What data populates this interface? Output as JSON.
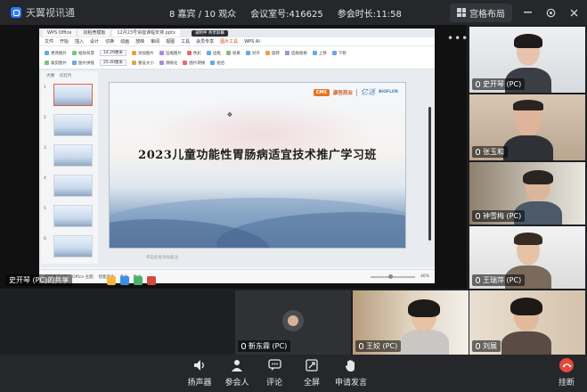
{
  "app": {
    "name": "天翼视讯通"
  },
  "topbar": {
    "attendance": "8 嘉宾 / 10 观众",
    "meeting_id": "会议室号:416625",
    "duration": "参会时长:11:58",
    "layout_button": "宫格布局"
  },
  "shared_screen": {
    "label": "史开琴 (PC)的共享",
    "wps": {
      "tabs": [
        "WPS Office",
        "找稻壳模板",
        "12月23号讲座课程安排.pptx"
      ],
      "recording": "录制中 共享屏幕",
      "menu": [
        "文件",
        "开始",
        "插入",
        "设计",
        "切换",
        "动画",
        "放映",
        "审阅",
        "视图",
        "工具",
        "会员专享",
        "图片工具",
        "WPS AI"
      ],
      "active_menu": "图片工具",
      "ribbon_row1": [
        "更改图片",
        "抠除背景",
        "14.29厘米",
        "添加图片",
        "压缩图片",
        "色彩",
        "边框",
        "效果",
        "对齐",
        "旋转",
        "选择窗格",
        "上移",
        "下移"
      ],
      "ribbon_row2": [
        "裁剪图片",
        "图片拼接",
        "25.40厘米",
        "重设大小",
        "清晰化",
        "图片转换",
        "组合"
      ],
      "thumb_tabs": [
        "大纲",
        "幻灯片"
      ],
      "thumb_numbers": [
        "1",
        "2",
        "3",
        "4",
        "5",
        "6"
      ],
      "slide": {
        "title": "2023儿童功能性胃肠病适宜技术推广学习班",
        "logo_cms": "CMS",
        "logo_cms_text": "康哲药业",
        "logo_yijie": "亿活",
        "logo_bio": "BIOFLOR"
      },
      "notes_hint": "单击此处添加备注",
      "status": [
        "幻灯片 1 / 5",
        "Office 主题",
        "智能美化",
        "备注",
        "批注"
      ],
      "zoom": "46%"
    }
  },
  "participants": [
    {
      "name": "史开琴 (PC)"
    },
    {
      "name": "张玉和"
    },
    {
      "name": "钟雪梅 (PC)"
    },
    {
      "name": "王瑞萍 (PC)"
    },
    {
      "name": "靳东霖 (PC)"
    },
    {
      "name": "王姣 (PC)"
    },
    {
      "name": "刘展"
    }
  ],
  "controls": [
    "扬声器",
    "参会人",
    "评论",
    "全屏",
    "申请发言",
    "挂断"
  ],
  "colors": {
    "accent": "#2e7cf6",
    "leave": "#e5483d",
    "bar": "#25272b"
  }
}
